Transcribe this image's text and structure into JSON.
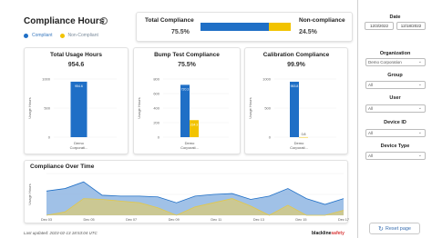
{
  "header": {
    "title": "Compliance Hours",
    "info_icon": "info-icon",
    "legend": [
      {
        "label": "Compliant",
        "color": "#1f6fc6"
      },
      {
        "label": "Non-Compliant",
        "color": "#f2c300"
      }
    ]
  },
  "ratio": {
    "left_label": "Total Compliance",
    "left_value": "75.5%",
    "right_label": "Non-compliance",
    "right_value": "24.5%",
    "compliant_fraction": 0.755,
    "compliant_color": "#1f6fc6",
    "noncompliant_color": "#f2c300"
  },
  "metrics": [
    {
      "title": "Total Usage Hours",
      "value": "954.6",
      "ylabel": "Usage Hours",
      "ticks": [
        "1000",
        "500",
        "0"
      ],
      "category": [
        "Demo",
        "Corporati..."
      ],
      "bars": [
        {
          "value": 954.6,
          "color": "#1f6fc6",
          "label": "954.6"
        }
      ],
      "ymax": 1000
    },
    {
      "title": "Bump Test Compliance",
      "value": "75.5%",
      "ylabel": "Usage Hours",
      "ticks": [
        "800",
        "600",
        "400",
        "200",
        "0"
      ],
      "category": [
        "Demo",
        "Corporati..."
      ],
      "bars": [
        {
          "value": 720.3,
          "color": "#1f6fc6",
          "label": "720.3"
        },
        {
          "value": 234.3,
          "color": "#f2c300",
          "label": "234.3"
        }
      ],
      "ymax": 800
    },
    {
      "title": "Calibration Compliance",
      "value": "99.9%",
      "ylabel": "Usage Hours",
      "ticks": [
        "1000",
        "500",
        "0"
      ],
      "category": [
        "Demo",
        "Corporati..."
      ],
      "bars": [
        {
          "value": 953.8,
          "color": "#1f6fc6",
          "label": "953.8"
        },
        {
          "value": 0.8,
          "color": "#f2c300",
          "label": "0.8"
        }
      ],
      "ymax": 1000
    }
  ],
  "chart_data": {
    "type": "area",
    "title": "Compliance Over Time",
    "ylabel": "Usage Hours",
    "xlabels": [
      "Dec 03",
      "Dec 05",
      "Dec 07",
      "Dec 09",
      "Dec 11",
      "Dec 13",
      "Dec 15",
      "Dec 17"
    ],
    "ymax": 100,
    "series": [
      {
        "name": "Compliant",
        "color": "#1f6fc6",
        "fill": "#8fb6e3",
        "values": [
          58,
          64,
          80,
          48,
          46,
          46,
          44,
          30,
          46,
          50,
          52,
          38,
          46,
          64,
          40,
          26,
          40
        ]
      },
      {
        "name": "Non-Compliant",
        "color": "#e2c84a",
        "fill": "#cfc98a",
        "values": [
          0,
          8,
          40,
          38,
          34,
          30,
          18,
          0,
          20,
          30,
          40,
          22,
          0,
          24,
          0,
          0,
          12
        ]
      }
    ]
  },
  "footer": {
    "updated": "Last updated: 2023-02-13 18:53:04 UTC",
    "brand_a": "blackline",
    "brand_b": "safety"
  },
  "filters": {
    "date_label": "Date",
    "date_from": "12/3/2022",
    "date_to": "12/18/2022",
    "organization_label": "Organization",
    "organization_value": "Demo Corporation",
    "group_label": "Group",
    "group_value": "All",
    "user_label": "User",
    "user_value": "All",
    "device_id_label": "Device ID",
    "device_id_value": "All",
    "device_type_label": "Device Type",
    "device_type_value": "All",
    "reset_label": "Reset page"
  }
}
